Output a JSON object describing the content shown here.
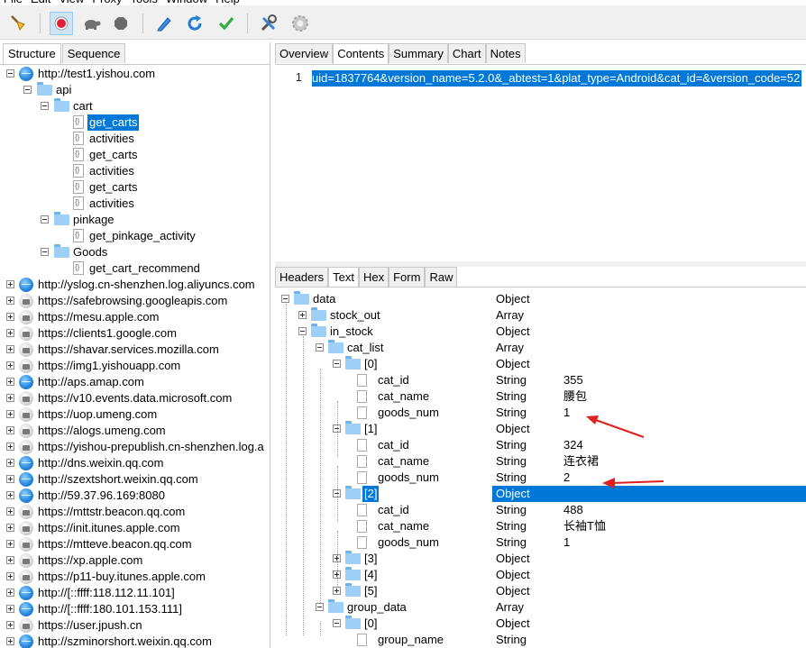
{
  "menu": [
    "File",
    "Edit",
    "View",
    "Proxy",
    "Tools",
    "Window",
    "Help"
  ],
  "toolbar": {
    "buttons": [
      "broom-icon",
      "record-icon",
      "turtle-icon",
      "stop-hexagon-icon",
      "pen-icon",
      "refresh-icon",
      "check-icon",
      "tools-icon",
      "settings-gear-icon"
    ]
  },
  "left_tabs": [
    "Structure",
    "Sequence"
  ],
  "tree": [
    {
      "depth": 0,
      "icon": "globe",
      "label": "http://test1.yishou.com",
      "expander": "minus"
    },
    {
      "depth": 1,
      "icon": "folder",
      "label": "api",
      "expander": "minus"
    },
    {
      "depth": 2,
      "icon": "folder",
      "label": "cart",
      "expander": "minus"
    },
    {
      "depth": 3,
      "icon": "doc",
      "label": "get_carts",
      "selected": true
    },
    {
      "depth": 3,
      "icon": "doc",
      "label": "activities"
    },
    {
      "depth": 3,
      "icon": "doc",
      "label": "get_carts"
    },
    {
      "depth": 3,
      "icon": "doc",
      "label": "activities"
    },
    {
      "depth": 3,
      "icon": "doc",
      "label": "get_carts"
    },
    {
      "depth": 3,
      "icon": "doc",
      "label": "activities"
    },
    {
      "depth": 2,
      "icon": "folder",
      "label": "pinkage",
      "expander": "minus"
    },
    {
      "depth": 3,
      "icon": "doc",
      "label": "get_pinkage_activity"
    },
    {
      "depth": 2,
      "icon": "folder",
      "label": "Goods",
      "expander": "minus"
    },
    {
      "depth": 3,
      "icon": "doc",
      "label": "get_cart_recommend"
    },
    {
      "depth": 0,
      "icon": "globe",
      "label": "http://yslog.cn-shenzhen.log.aliyuncs.com",
      "expander": "plus"
    },
    {
      "depth": 0,
      "icon": "lock",
      "label": "https://safebrowsing.googleapis.com",
      "expander": "plus"
    },
    {
      "depth": 0,
      "icon": "lock",
      "label": "https://mesu.apple.com",
      "expander": "plus"
    },
    {
      "depth": 0,
      "icon": "lock",
      "label": "https://clients1.google.com",
      "expander": "plus"
    },
    {
      "depth": 0,
      "icon": "lock",
      "label": "https://shavar.services.mozilla.com",
      "expander": "plus"
    },
    {
      "depth": 0,
      "icon": "lock",
      "label": "https://img1.yishouapp.com",
      "expander": "plus"
    },
    {
      "depth": 0,
      "icon": "globe",
      "label": "http://aps.amap.com",
      "expander": "plus"
    },
    {
      "depth": 0,
      "icon": "lock",
      "label": "https://v10.events.data.microsoft.com",
      "expander": "plus"
    },
    {
      "depth": 0,
      "icon": "lock",
      "label": "https://uop.umeng.com",
      "expander": "plus"
    },
    {
      "depth": 0,
      "icon": "lock",
      "label": "https://alogs.umeng.com",
      "expander": "plus"
    },
    {
      "depth": 0,
      "icon": "lock",
      "label": "https://yishou-prepublish.cn-shenzhen.log.a",
      "expander": "plus"
    },
    {
      "depth": 0,
      "icon": "globe",
      "label": "http://dns.weixin.qq.com",
      "expander": "plus"
    },
    {
      "depth": 0,
      "icon": "globe",
      "label": "http://szextshort.weixin.qq.com",
      "expander": "plus"
    },
    {
      "depth": 0,
      "icon": "globe",
      "label": "http://59.37.96.169:8080",
      "expander": "plus"
    },
    {
      "depth": 0,
      "icon": "lock",
      "label": "https://mttstr.beacon.qq.com",
      "expander": "plus"
    },
    {
      "depth": 0,
      "icon": "lock",
      "label": "https://init.itunes.apple.com",
      "expander": "plus"
    },
    {
      "depth": 0,
      "icon": "lock",
      "label": "https://mtteve.beacon.qq.com",
      "expander": "plus"
    },
    {
      "depth": 0,
      "icon": "lock",
      "label": "https://xp.apple.com",
      "expander": "plus"
    },
    {
      "depth": 0,
      "icon": "lock",
      "label": "https://p11-buy.itunes.apple.com",
      "expander": "plus"
    },
    {
      "depth": 0,
      "icon": "globe",
      "label": "http://[::ffff:118.112.11.101]",
      "expander": "plus"
    },
    {
      "depth": 0,
      "icon": "globe",
      "label": "http://[::ffff:180.101.153.111]",
      "expander": "plus"
    },
    {
      "depth": 0,
      "icon": "lock",
      "label": "https://user.jpush.cn",
      "expander": "plus"
    },
    {
      "depth": 0,
      "icon": "globe",
      "label": "http://szminorshort.weixin.qq.com",
      "expander": "plus"
    }
  ],
  "right_tabs": [
    "Overview",
    "Contents",
    "Summary",
    "Chart",
    "Notes"
  ],
  "right_tabs_active": 1,
  "request": {
    "line_number": "1",
    "text": "uid=1837764&version_name=5.2.0&_abtest=1&plat_type=Android&cat_id=&version_code=52"
  },
  "response_tabs": [
    "Headers",
    "Text",
    "Hex",
    "Form",
    "Raw"
  ],
  "response_tabs_active": 1,
  "response_tree": [
    {
      "depth": 0,
      "kind": "folder",
      "exp": "minus",
      "name": "data",
      "type": "Object",
      "value": ""
    },
    {
      "depth": 1,
      "kind": "folder",
      "exp": "plus",
      "name": "stock_out",
      "type": "Array",
      "value": ""
    },
    {
      "depth": 1,
      "kind": "folder",
      "exp": "minus",
      "name": "in_stock",
      "type": "Object",
      "value": ""
    },
    {
      "depth": 2,
      "kind": "folder",
      "exp": "minus",
      "name": "cat_list",
      "type": "Array",
      "value": ""
    },
    {
      "depth": 3,
      "kind": "folder",
      "exp": "minus",
      "name": "[0]",
      "type": "Object",
      "value": ""
    },
    {
      "depth": 4,
      "kind": "file",
      "name": "cat_id",
      "type": "String",
      "value": "355"
    },
    {
      "depth": 4,
      "kind": "file",
      "name": "cat_name",
      "type": "String",
      "value": "腰包"
    },
    {
      "depth": 4,
      "kind": "file",
      "name": "goods_num",
      "type": "String",
      "value": "1"
    },
    {
      "depth": 3,
      "kind": "folder",
      "exp": "minus",
      "name": "[1]",
      "type": "Object",
      "value": ""
    },
    {
      "depth": 4,
      "kind": "file",
      "name": "cat_id",
      "type": "String",
      "value": "324"
    },
    {
      "depth": 4,
      "kind": "file",
      "name": "cat_name",
      "type": "String",
      "value": "连衣裙"
    },
    {
      "depth": 4,
      "kind": "file",
      "name": "goods_num",
      "type": "String",
      "value": "2"
    },
    {
      "depth": 3,
      "kind": "folder",
      "exp": "minus",
      "name": "[2]",
      "type": "Object",
      "value": "",
      "selected": true
    },
    {
      "depth": 4,
      "kind": "file",
      "name": "cat_id",
      "type": "String",
      "value": "488"
    },
    {
      "depth": 4,
      "kind": "file",
      "name": "cat_name",
      "type": "String",
      "value": "长袖T恤"
    },
    {
      "depth": 4,
      "kind": "file",
      "name": "goods_num",
      "type": "String",
      "value": "1"
    },
    {
      "depth": 3,
      "kind": "folder",
      "exp": "plus",
      "name": "[3]",
      "type": "Object",
      "value": ""
    },
    {
      "depth": 3,
      "kind": "folder",
      "exp": "plus",
      "name": "[4]",
      "type": "Object",
      "value": ""
    },
    {
      "depth": 3,
      "kind": "folder",
      "exp": "plus",
      "name": "[5]",
      "type": "Object",
      "value": ""
    },
    {
      "depth": 2,
      "kind": "folder",
      "exp": "minus",
      "name": "group_data",
      "type": "Array",
      "value": ""
    },
    {
      "depth": 3,
      "kind": "folder",
      "exp": "minus",
      "name": "[0]",
      "type": "Object",
      "value": ""
    },
    {
      "depth": 4,
      "kind": "file",
      "name": "group_name",
      "type": "String",
      "value": ""
    }
  ],
  "colors": {
    "selection": "#0078d7",
    "arrow": "#e0201c"
  }
}
